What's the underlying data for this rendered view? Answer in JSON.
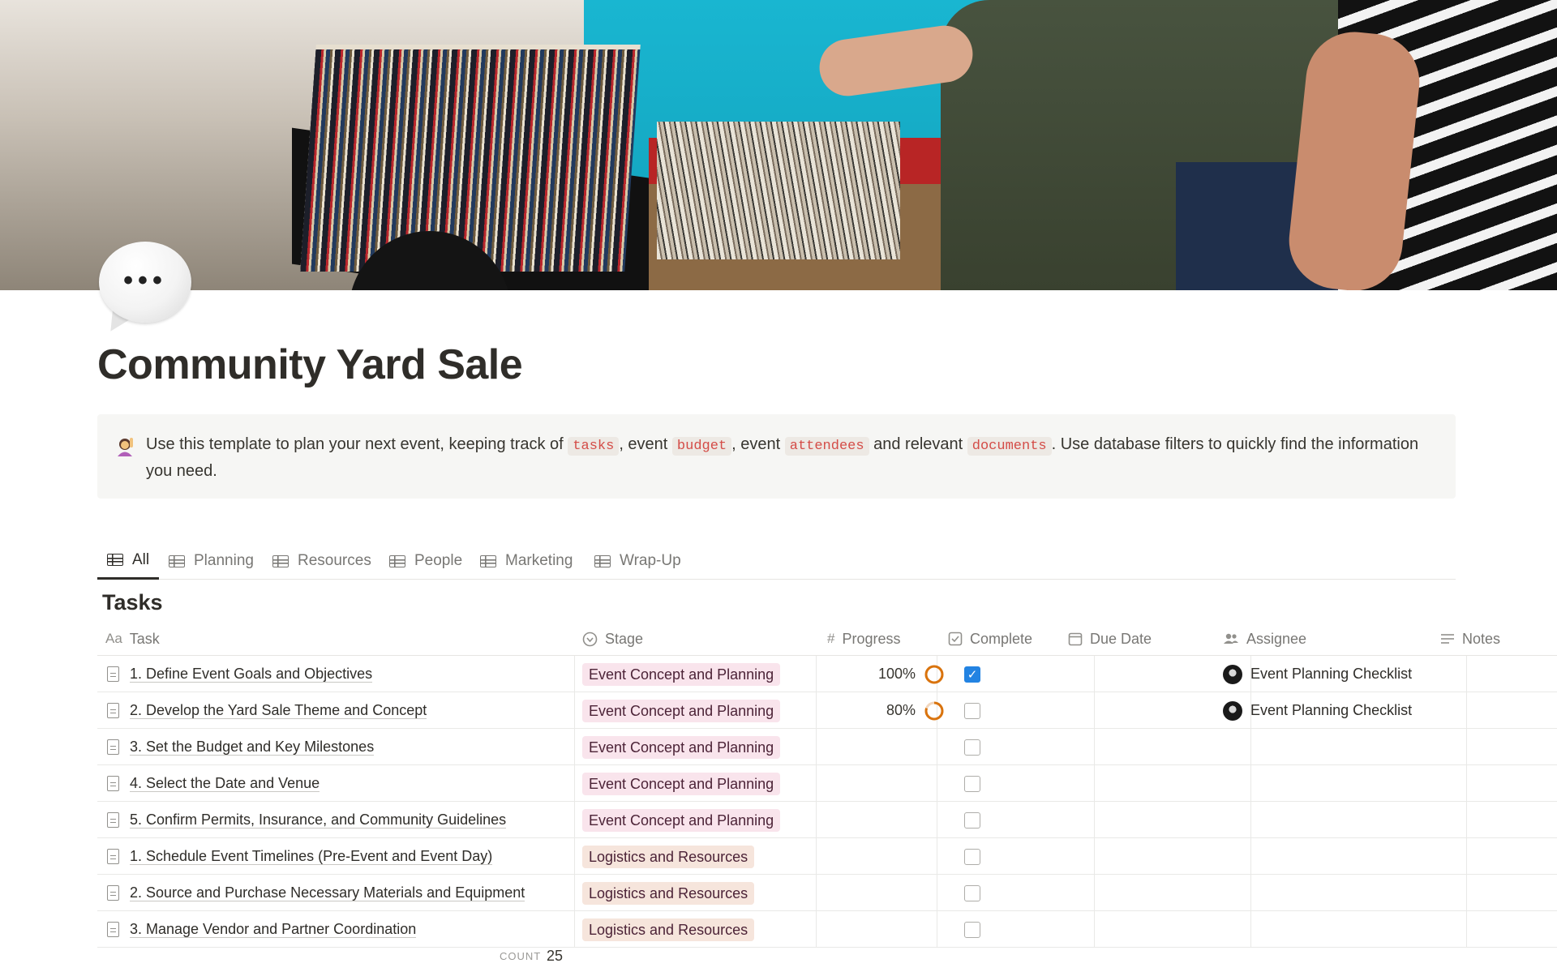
{
  "page": {
    "title": "Community Yard Sale",
    "icon": "speech-balloon-icon",
    "icon_text": "•••"
  },
  "callout": {
    "icon": "woman-raising-hand-icon",
    "text_1": "Use this template to plan your next event, keeping track of ",
    "code_1": "tasks",
    "text_2": ", event ",
    "code_2": "budget",
    "text_3": ", event ",
    "code_3": "attendees",
    "text_4": " and relevant ",
    "code_4": "documents",
    "text_5": ". Use database filters to quickly find the information you need."
  },
  "tabs": [
    {
      "label": "All",
      "active": true
    },
    {
      "label": "Planning",
      "active": false
    },
    {
      "label": "Resources",
      "active": false
    },
    {
      "label": "People",
      "active": false
    },
    {
      "label": "Marketing",
      "active": false
    },
    {
      "label": "Wrap-Up",
      "active": false
    }
  ],
  "database": {
    "title": "Tasks",
    "columns": {
      "task": {
        "label": "Task",
        "icon": "Aa"
      },
      "stage": {
        "label": "Stage",
        "icon": "status-icon"
      },
      "progress": {
        "label": "Progress",
        "icon": "#"
      },
      "complete": {
        "label": "Complete",
        "icon": "checkbox-icon"
      },
      "due": {
        "label": "Due Date",
        "icon": "calendar-icon"
      },
      "assignee": {
        "label": "Assignee",
        "icon": "people-icon"
      },
      "notes": {
        "label": "Notes",
        "icon": "text-lines-icon"
      }
    },
    "rows": [
      {
        "task": "1. Define Event Goals and Objectives",
        "stage": "Event Concept and Planning",
        "stage_color": "#f9e4ec",
        "progress": "100%",
        "progress_value": 1.0,
        "complete": true,
        "assignee": "Event Planning Checklist"
      },
      {
        "task": "2. Develop the Yard Sale Theme and Concept",
        "stage": "Event Concept and Planning",
        "stage_color": "#f9e4ec",
        "progress": "80%",
        "progress_value": 0.8,
        "complete": false,
        "assignee": "Event Planning Checklist"
      },
      {
        "task": "3. Set the Budget and Key Milestones",
        "stage": "Event Concept and Planning",
        "stage_color": "#f9e4ec",
        "progress": "",
        "progress_value": null,
        "complete": false,
        "assignee": ""
      },
      {
        "task": "4. Select the Date and Venue",
        "stage": "Event Concept and Planning",
        "stage_color": "#f9e4ec",
        "progress": "",
        "progress_value": null,
        "complete": false,
        "assignee": ""
      },
      {
        "task": "5. Confirm Permits, Insurance, and Community Guidelines",
        "stage": "Event Concept and Planning",
        "stage_color": "#f9e4ec",
        "progress": "",
        "progress_value": null,
        "complete": false,
        "assignee": ""
      },
      {
        "task": "1. Schedule Event Timelines (Pre-Event and Event Day)",
        "stage": "Logistics and Resources",
        "stage_color": "#f6e5dc",
        "progress": "",
        "progress_value": null,
        "complete": false,
        "assignee": ""
      },
      {
        "task": "2. Source and Purchase Necessary Materials and Equipment",
        "stage": "Logistics and Resources",
        "stage_color": "#f6e5dc",
        "progress": "",
        "progress_value": null,
        "complete": false,
        "assignee": ""
      },
      {
        "task": "3. Manage Vendor and Partner Coordination",
        "stage": "Logistics and Resources",
        "stage_color": "#f6e5dc",
        "progress": "",
        "progress_value": null,
        "complete": false,
        "assignee": ""
      }
    ],
    "footer": {
      "count_label": "COUNT",
      "count_value": "25"
    }
  },
  "colors": {
    "progress_ring": "#d9730d",
    "checkbox_checked": "#2383e2",
    "code_text": "#d44c47"
  }
}
